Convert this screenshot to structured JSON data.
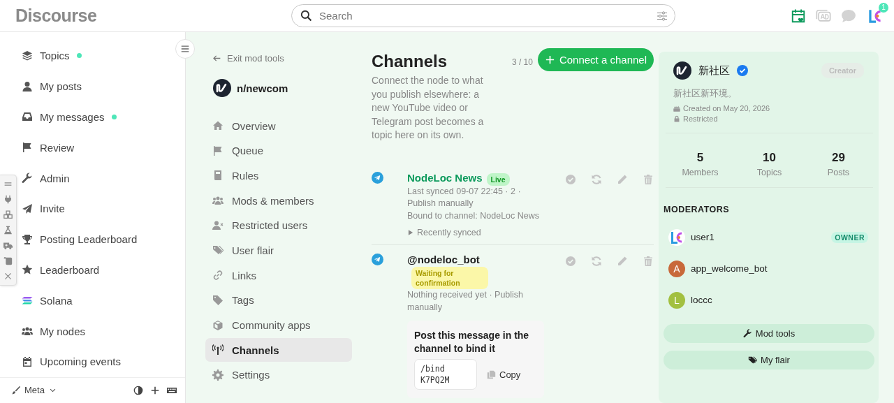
{
  "header": {
    "logo": "Discourse",
    "search": {
      "placeholder": "Search"
    },
    "avatar_badge": "1"
  },
  "sidebar": {
    "items": [
      {
        "label": "Topics",
        "unread": true
      },
      {
        "label": "My posts",
        "unread": false
      },
      {
        "label": "My messages",
        "unread": true
      },
      {
        "label": "Review",
        "unread": false
      },
      {
        "label": "Admin",
        "unread": false
      },
      {
        "label": "Invite",
        "unread": false
      },
      {
        "label": "Posting Leaderboard",
        "unread": false
      },
      {
        "label": "Leaderboard",
        "unread": false
      },
      {
        "label": "Solana",
        "unread": false
      },
      {
        "label": "My nodes",
        "unread": false
      },
      {
        "label": "Upcoming events",
        "unread": false
      }
    ],
    "footer": {
      "label": "Meta"
    }
  },
  "mod_nav": {
    "exit": "Exit mod tools",
    "community": "n/newcom",
    "items": [
      {
        "label": "Overview",
        "selected": false
      },
      {
        "label": "Queue",
        "selected": false
      },
      {
        "label": "Rules",
        "selected": false
      },
      {
        "label": "Mods & members",
        "selected": false
      },
      {
        "label": "Restricted users",
        "selected": false
      },
      {
        "label": "User flair",
        "selected": false
      },
      {
        "label": "Links",
        "selected": false
      },
      {
        "label": "Tags",
        "selected": false
      },
      {
        "label": "Community apps",
        "selected": false
      },
      {
        "label": "Channels",
        "selected": true
      },
      {
        "label": "Settings",
        "selected": false
      }
    ]
  },
  "channels": {
    "title": "Channels",
    "count": "3 / 10",
    "connect_button": "Connect a channel",
    "description": "Connect the node to what you publish elsewhere: a new YouTube video or Telegram post becomes a topic here on its own.",
    "items": [
      {
        "name": "NodeLoc News",
        "status": {
          "label": "Live",
          "kind": "live"
        },
        "meta": [
          "Last synced 09-07 22:45 · 2 · Publish manually",
          "Bound to channel: NodeLoc News"
        ],
        "footer": "Recently synced"
      },
      {
        "name": "@nodeloc_bot",
        "status": {
          "label": "Waiting for confirmation",
          "kind": "waiting"
        },
        "meta": [
          "Nothing received yet · Publish manually"
        ],
        "bind": {
          "title": "Post this message in the channel to bind it",
          "code": "/bind K7PQ2M",
          "copy": "Copy"
        }
      }
    ]
  },
  "community_card": {
    "name": "新社区",
    "verified": true,
    "role": "Creator",
    "description": "新社区新环境。",
    "created": "Created on May 20, 2026",
    "access": "Restricted",
    "stats": [
      {
        "value": "5",
        "label": "Members"
      },
      {
        "value": "10",
        "label": "Topics"
      },
      {
        "value": "29",
        "label": "Posts"
      }
    ],
    "moderators_heading": "MODERATORS",
    "moderators": [
      {
        "name": "user1",
        "avatar": {
          "kind": "logo"
        },
        "badge": "OWNER"
      },
      {
        "name": "app_welcome_bot",
        "avatar": {
          "kind": "letter",
          "letter": "A",
          "color": "#c8693a"
        }
      },
      {
        "name": "loccc",
        "avatar": {
          "kind": "letter",
          "letter": "L",
          "color": "#a2c040"
        }
      }
    ],
    "buttons": [
      "Mod tools",
      "My flair"
    ]
  }
}
